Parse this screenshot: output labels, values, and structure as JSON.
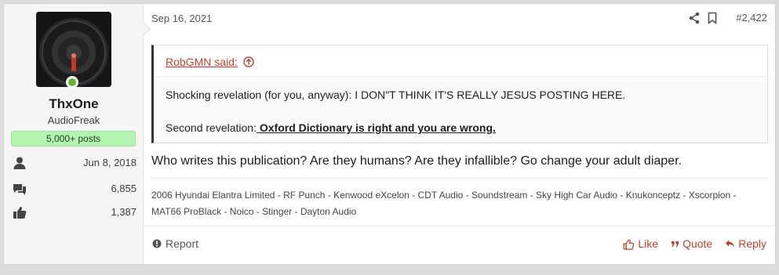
{
  "user": {
    "name": "ThxOne",
    "title": "AudioFreak",
    "posts_badge": "5,000+ posts",
    "joined": "Jun 8, 2018",
    "messages": "6,855",
    "reactions": "1,387"
  },
  "post": {
    "date": "Sep 16, 2021",
    "number": "#2,422",
    "quote": {
      "author": "RobGMN said:",
      "line1": "Shocking revelation (for you, anyway): I DON\"T THINK IT'S REALLY JESUS POSTING HERE.",
      "line2_prefix": "Second revelation:",
      "line2_bold": " Oxford Dictionary is right and you are wrong."
    },
    "message": "Who writes this publication? Are they humans? Are they infallible? Go change your adult diaper.",
    "signature": "2006 Hyundai Elantra Limited - RF Punch - Kenwood eXcelon - CDT Audio - Soundstream - Sky High Car Audio - Knukonceptz - Xscorpion - MAT66 ProBlack - Noico - Stinger - Dayton Audio"
  },
  "footer": {
    "report": "Report",
    "like": "Like",
    "quote": "Quote",
    "reply": "Reply"
  },
  "colors": {
    "accent": "#b8442f",
    "badge_bg": "#b3f5b0",
    "online": "#63b32e"
  }
}
